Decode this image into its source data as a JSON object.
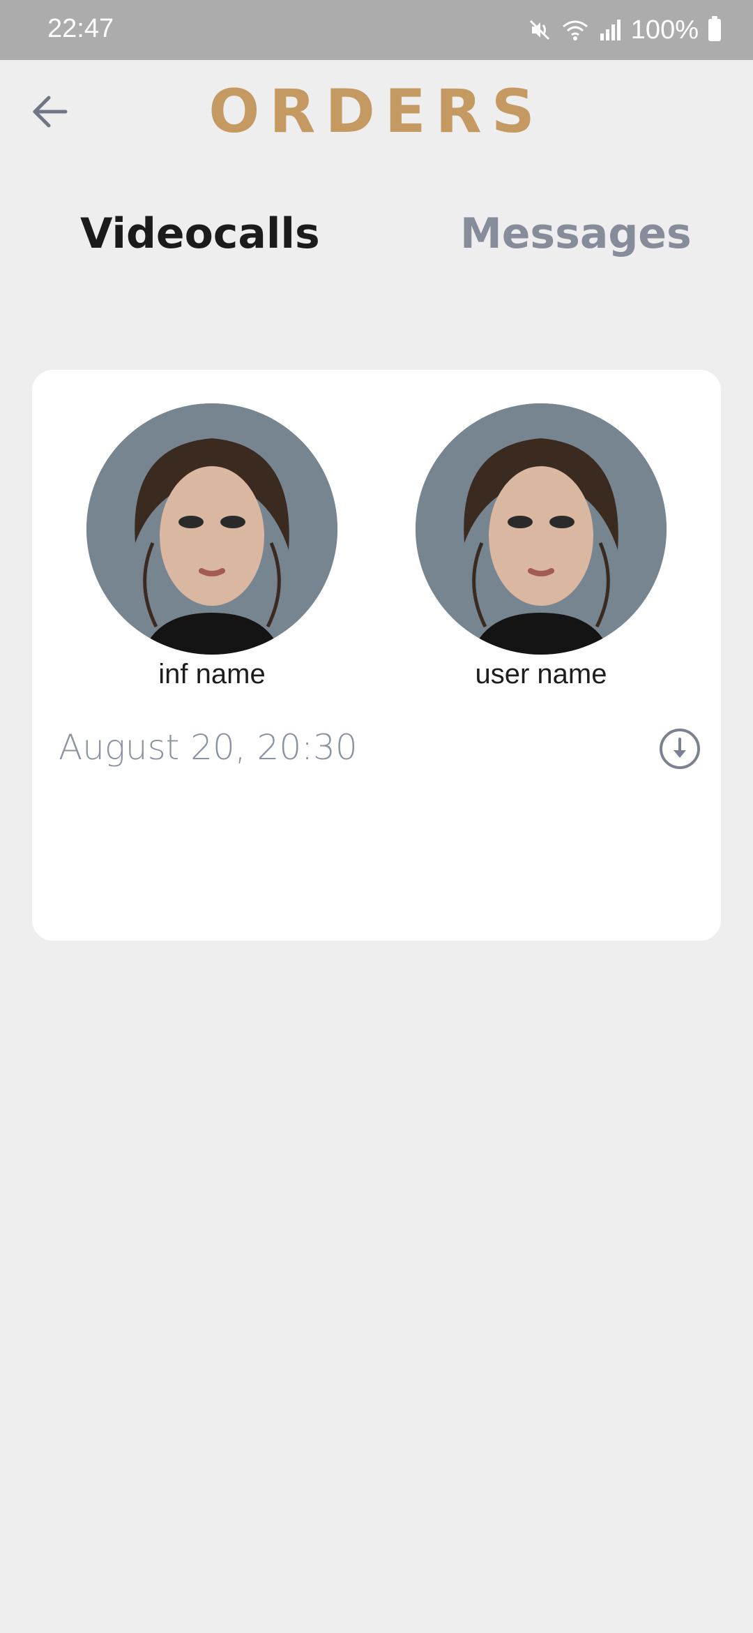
{
  "status_bar": {
    "time": "22:47",
    "battery": "100%",
    "icons": [
      "mute-icon",
      "wifi-icon",
      "signal-icon",
      "battery-icon"
    ]
  },
  "header": {
    "title": "ORDERS",
    "back_icon": "arrow-left-icon"
  },
  "tabs": [
    {
      "label": "Videocalls",
      "active": true
    },
    {
      "label": "Messages",
      "active": false
    }
  ],
  "order": {
    "influencer_name": "inf name",
    "user_name": "user name",
    "date": "August 20, 20:30",
    "action_icon": "download-circle-icon"
  },
  "colors": {
    "accent": "#c49a62",
    "background": "#eeeeee",
    "status_bar": "#acacac",
    "inactive_tab": "#868c99",
    "muted_text": "#8c93a0"
  }
}
